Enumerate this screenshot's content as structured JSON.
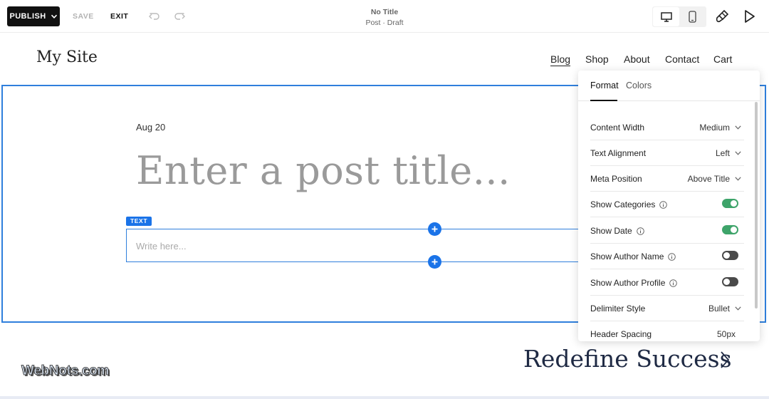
{
  "toolbar": {
    "publish_label": "PUBLISH",
    "save_label": "SAVE",
    "exit_label": "EXIT",
    "doc_title": "No Title",
    "doc_status": "Post · Draft",
    "icons": [
      "chevron-down-icon",
      "undo-icon",
      "redo-icon",
      "desktop-icon",
      "mobile-icon",
      "paintbrush-icon",
      "play-icon"
    ]
  },
  "site": {
    "title": "My Site",
    "nav": [
      "Blog",
      "Shop",
      "About",
      "Contact",
      "Cart"
    ]
  },
  "post": {
    "date": "Aug 20",
    "title_placeholder": "Enter a post title...",
    "block_tag": "TEXT",
    "body_placeholder": "Write here..."
  },
  "panel": {
    "tabs": [
      "Format",
      "Colors"
    ],
    "active_tab": "Format",
    "rows": [
      {
        "label": "Content Width",
        "value": "Medium",
        "type": "dropdown"
      },
      {
        "label": "Text Alignment",
        "value": "Left",
        "type": "dropdown"
      },
      {
        "label": "Meta Position",
        "value": "Above Title",
        "type": "dropdown"
      },
      {
        "label": "Show Categories",
        "type": "toggle",
        "on": true,
        "info": true
      },
      {
        "label": "Show Date",
        "type": "toggle",
        "on": true,
        "info": true
      },
      {
        "label": "Show Author Name",
        "type": "toggle",
        "on": false,
        "info": true
      },
      {
        "label": "Show Author Profile",
        "type": "toggle",
        "on": false,
        "info": true
      },
      {
        "label": "Delimiter Style",
        "value": "Bullet",
        "type": "dropdown"
      },
      {
        "label": "Header Spacing",
        "value": "50px",
        "type": "value"
      }
    ]
  },
  "next_post": {
    "title": "Redefine Success"
  },
  "watermark": "WebNots.com",
  "colors": {
    "accent": "#1a73e8",
    "frame": "#2f7fdc",
    "toggle_on": "#3ea46a",
    "toggle_off": "#4a4a4a",
    "next_title": "#1f2a44"
  }
}
